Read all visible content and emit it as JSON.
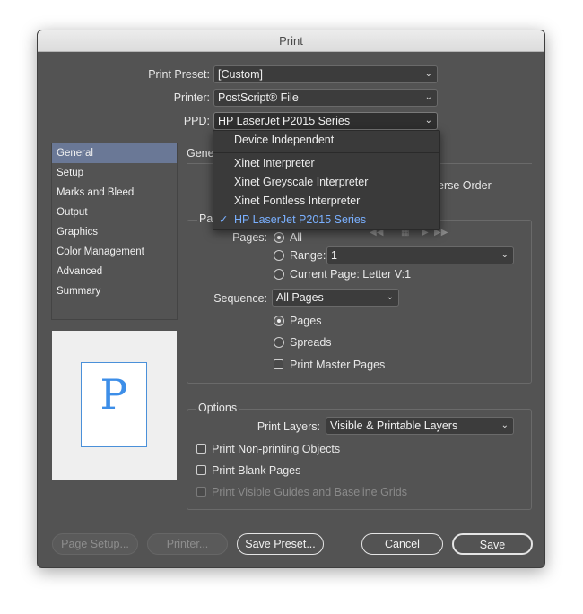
{
  "window": {
    "title": "Print"
  },
  "header": {
    "print_preset": {
      "label": "Print Preset:",
      "value": "[Custom]"
    },
    "printer": {
      "label": "Printer:",
      "value": "PostScript® File"
    },
    "ppd": {
      "label": "PPD:",
      "value": "HP LaserJet P2015 Series"
    }
  },
  "ppd_menu": {
    "items": [
      {
        "label": "Device Independent"
      },
      {
        "label": "Xinet Interpreter"
      },
      {
        "label": "Xinet Greyscale Interpreter"
      },
      {
        "label": "Xinet Fontless Interpreter"
      },
      {
        "label": "HP LaserJet P2015 Series",
        "checked": true
      }
    ],
    "check_glyph": "✓"
  },
  "sidebar": {
    "items": [
      {
        "label": "General"
      },
      {
        "label": "Setup"
      },
      {
        "label": "Marks and Bleed"
      },
      {
        "label": "Output"
      },
      {
        "label": "Graphics"
      },
      {
        "label": "Color Management"
      },
      {
        "label": "Advanced"
      },
      {
        "label": "Summary"
      }
    ],
    "selected": "General"
  },
  "preview": {
    "letter": "P"
  },
  "general": {
    "heading_partial": "Genel",
    "reverse_order_partial": "erse Order",
    "pages_group_partial": "Pag",
    "pages_label": "Pages:",
    "all_label": "All",
    "range_label": "Range:",
    "range_value": "1",
    "current_page_label": "Current Page: Letter V:1",
    "sequence_label": "Sequence:",
    "sequence_value": "All Pages",
    "pages_radio_label": "Pages",
    "spreads_radio_label": "Spreads",
    "print_master_pages_label": "Print Master Pages"
  },
  "options": {
    "title": "Options",
    "print_layers_label": "Print Layers:",
    "print_layers_value": "Visible & Printable Layers",
    "non_printing_label": "Print Non-printing Objects",
    "blank_pages_label": "Print Blank Pages",
    "guides_label": "Print Visible Guides and Baseline Grids"
  },
  "footer": {
    "page_setup": "Page Setup...",
    "printer": "Printer...",
    "save_preset": "Save Preset...",
    "cancel": "Cancel",
    "save": "Save"
  }
}
